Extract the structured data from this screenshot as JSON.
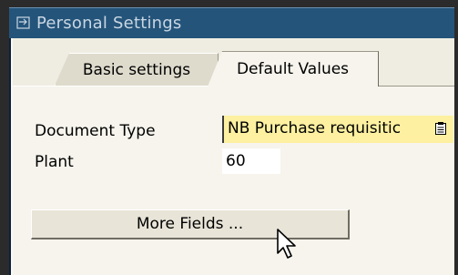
{
  "window": {
    "title": "Personal Settings",
    "title_icon": "settings-window-icon"
  },
  "tabs": [
    {
      "label": "Basic settings",
      "active": false
    },
    {
      "label": "Default Values",
      "active": true
    }
  ],
  "fields": {
    "document_type": {
      "label": "Document Type",
      "value": "NB Purchase requisitic",
      "icon": "list-icon"
    },
    "plant": {
      "label": "Plant",
      "value": "60"
    }
  },
  "buttons": {
    "more_fields": "More Fields ..."
  },
  "colors": {
    "titlebar": "#24547a",
    "title_text": "#c9d6e3",
    "required_field": "#fdf0a0",
    "panel": "#efede2"
  }
}
